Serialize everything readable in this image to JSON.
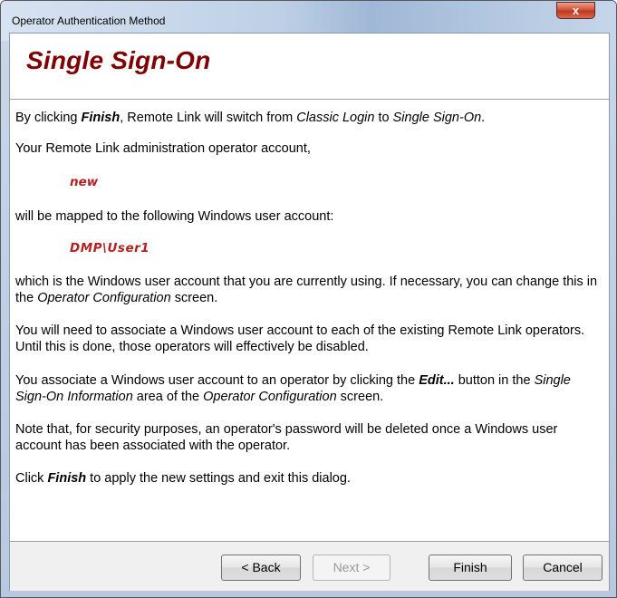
{
  "window": {
    "title": "Operator Authentication Method",
    "close_label": "x"
  },
  "header": {
    "title": "Single Sign-On"
  },
  "content": {
    "p1_a": "By clicking ",
    "p1_b": "Finish",
    "p1_c": ", Remote Link will switch from ",
    "p1_d": "Classic Login",
    "p1_e": " to ",
    "p1_f": "Single Sign-On",
    "p1_g": ".",
    "p2": "Your Remote Link administration operator account,",
    "operator_account": "new",
    "p3": "will be mapped to the following Windows user account:",
    "windows_account": "DMP\\User1",
    "p4_a": "which is the Windows user account that you are currently using.  If necessary, you can change this in the ",
    "p4_b": "Operator Configuration",
    "p4_c": " screen.",
    "p5": "You will need to associate a Windows user account to each of the existing Remote Link operators.  Until this is done, those operators will effectively be disabled.",
    "p6_a": "You associate a Windows user account to an operator by clicking the ",
    "p6_b": "Edit...",
    "p6_c": " button in the ",
    "p6_d": "Single Sign-On Information",
    "p6_e": " area of the ",
    "p6_f": "Operator Configuration",
    "p6_g": " screen.",
    "p7": "Note that, for security purposes, an operator's password will be deleted once a Windows user account has been associated with the operator.",
    "p8_a": "Click ",
    "p8_b": "Finish",
    "p8_c": " to apply the new settings and exit this dialog."
  },
  "buttons": {
    "back": "< Back",
    "next": "Next >",
    "finish": "Finish",
    "cancel": "Cancel"
  }
}
